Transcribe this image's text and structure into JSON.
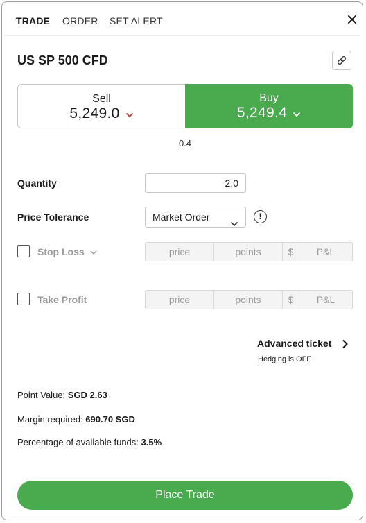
{
  "tabs": {
    "trade": "TRADE",
    "order": "ORDER",
    "alert": "SET ALERT"
  },
  "instrument": "US SP 500 CFD",
  "sell": {
    "label": "Sell",
    "price": "5,249.0"
  },
  "buy": {
    "label": "Buy",
    "price": "5,249.4"
  },
  "spread": "0.4",
  "quantity": {
    "label": "Quantity",
    "value": "2.0"
  },
  "price_tolerance": {
    "label": "Price Tolerance",
    "selected": "Market Order"
  },
  "stop_loss": {
    "label": "Stop Loss",
    "price": "price",
    "points": "points",
    "currency": "$",
    "pl": "P&L"
  },
  "take_profit": {
    "label": "Take Profit",
    "price": "price",
    "points": "points",
    "currency": "$",
    "pl": "P&L"
  },
  "advanced": {
    "label": "Advanced ticket",
    "hedging": "Hedging is OFF"
  },
  "summary": {
    "point_value_label": "Point Value:",
    "point_value": "SGD 2.63",
    "margin_label": "Margin required:",
    "margin": "690.70 SGD",
    "funds_label": "Percentage of available funds:",
    "funds": "3.5%"
  },
  "place_trade": "Place Trade",
  "colors": {
    "accent_green": "#4aaa4e",
    "sell_chevron": "#b03a2e"
  },
  "icons": {
    "close": "close-icon",
    "link": "link-icon",
    "info": "info-icon"
  }
}
